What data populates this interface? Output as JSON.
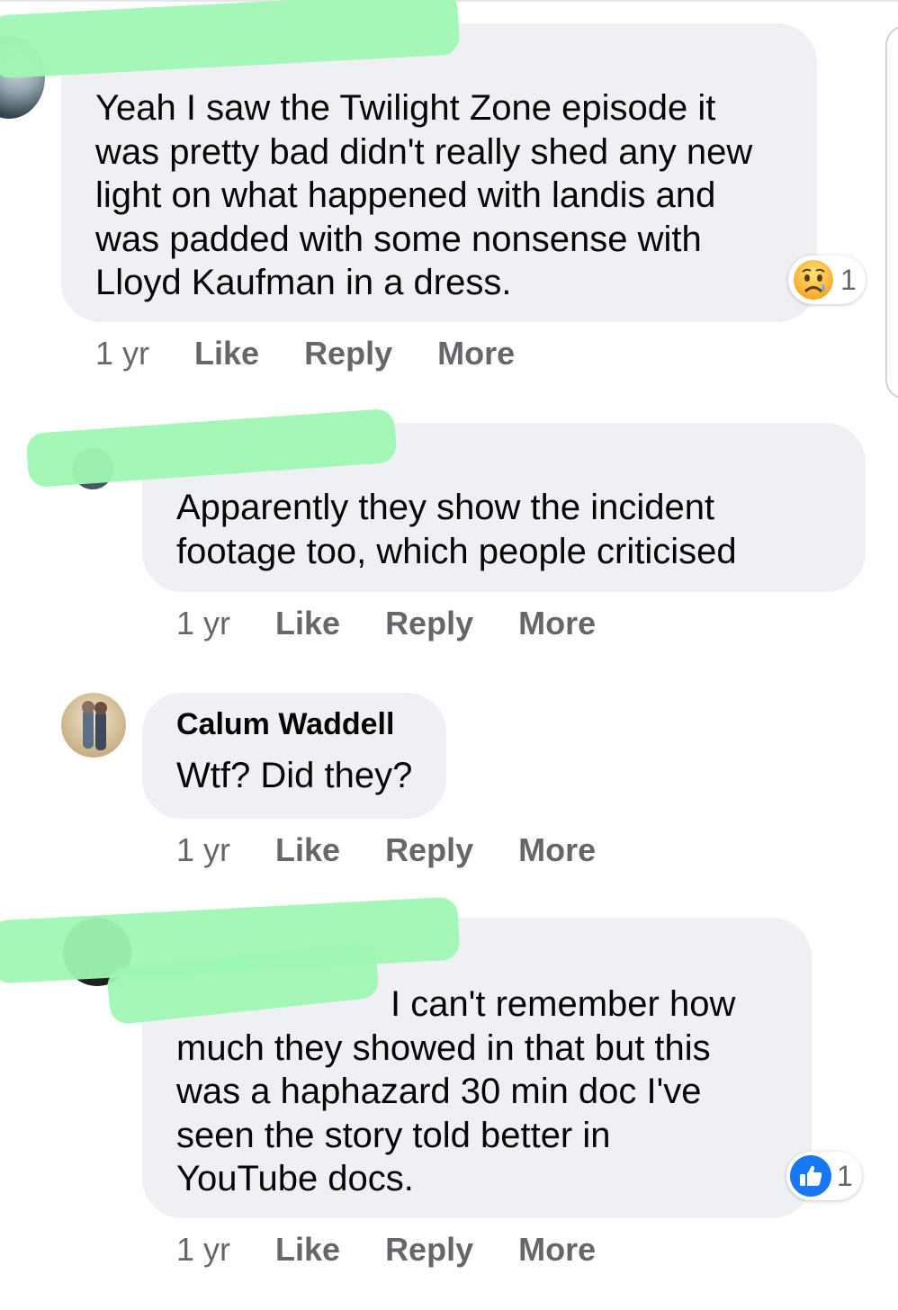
{
  "comments": [
    {
      "author": "",
      "lines": [
        "Yeah I saw the Twilight Zone episode it",
        "was pretty bad didn't really shed any new",
        "light on what happened with landis and",
        "was padded with some nonsense with",
        "Lloyd Kaufman in a dress."
      ],
      "reaction": {
        "icon": "sad-face-icon",
        "count": "1"
      }
    },
    {
      "author": "",
      "lines": [
        "Apparently they show the incident",
        "footage too, which people criticised"
      ]
    },
    {
      "author": "Calum Waddell",
      "lines": [
        "Wtf? Did they?"
      ]
    },
    {
      "author": "",
      "lines": [
        "I can't remember how",
        "much they showed in that but this",
        "was a haphazard 30 min doc I've",
        "seen the story told better in",
        "YouTube docs."
      ],
      "reaction": {
        "icon": "like-thumb-icon",
        "count": "1"
      }
    }
  ],
  "actions": {
    "time": "1 yr",
    "like": "Like",
    "reply": "Reply",
    "more": "More"
  },
  "colors": {
    "bubble": "#eef0f3",
    "action_text": "#65676b",
    "like_blue": "#1877f2",
    "redaction_green": "#9ff7b3"
  }
}
